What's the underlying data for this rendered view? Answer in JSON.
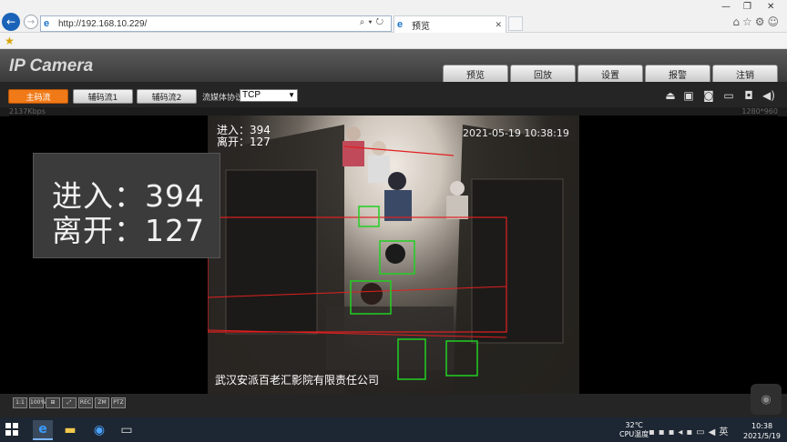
{
  "browser": {
    "url": "http://192.168.10.229/",
    "tab_title": "预览",
    "window_controls": [
      "—",
      "❐",
      "✕"
    ],
    "right_icons": [
      "home-icon",
      "star-icon",
      "gear-icon",
      "smiley-icon"
    ]
  },
  "app": {
    "title": "IP Camera",
    "nav_tabs": [
      "预览",
      "回放",
      "设置",
      "报警",
      "注销"
    ]
  },
  "toolbar": {
    "stream_buttons": [
      "主码流",
      "辅码流1",
      "辅码流2"
    ],
    "protocol_label": "流媒体协议",
    "protocol_value": "TCP",
    "icons": [
      "print-icon",
      "settings-icon",
      "snapshot-icon",
      "record-icon",
      "camera-icon",
      "volume-icon"
    ]
  },
  "status": {
    "bitrate": "2137Kbps",
    "resolution": "1280*960"
  },
  "video": {
    "in_line": "进入：394",
    "out_line": "离开：127",
    "datetime": "2021-05-19 10:38:19",
    "company": "武汉安派百老汇影院有限责任公司"
  },
  "zoom": {
    "in_line": "进入：394",
    "out_line": "离开：127"
  },
  "bottom_tools": [
    "1:1",
    "100%",
    "⊞",
    "⤢",
    "REC",
    "ZM",
    "PTZ"
  ],
  "taskbar": {
    "weather_temp": "32℃",
    "weather_label": "CPU温度",
    "ime": "英",
    "time": "10:38",
    "date": "2021/5/19"
  }
}
